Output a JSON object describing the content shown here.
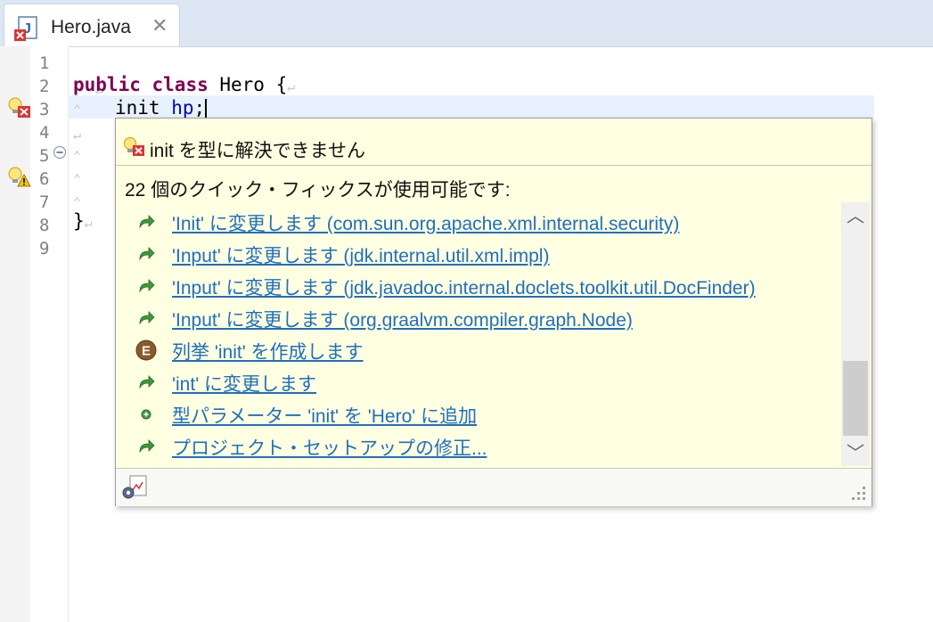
{
  "tab": {
    "title": "Hero.java",
    "close_glyph": "✕",
    "icon": "java-file-error-icon"
  },
  "editor": {
    "line_numbers": [
      "1",
      "2",
      "3",
      "4",
      "5",
      "6",
      "7",
      "8",
      "9"
    ],
    "lines": {
      "l2_kw1": "public",
      "l2_kw2": "class",
      "l2_rest": " Hero {",
      "l3_type": "init",
      "l3_var": "hp",
      "l3_semi": ";",
      "l8": "}"
    },
    "pilcrow": "↵",
    "tab_mark": "⌃"
  },
  "popup": {
    "title": "init を型に解決できません",
    "subtitle": "22 個のクイック・フィックスが使用可能です:",
    "fixes": [
      {
        "label": "'Init' に変更します (com.sun.org.apache.xml.internal.security)",
        "icon": "change-arrow-icon"
      },
      {
        "label": "'Input' に変更します (jdk.internal.util.xml.impl)",
        "icon": "change-arrow-icon"
      },
      {
        "label": "'Input' に変更します (jdk.javadoc.internal.doclets.toolkit.util.DocFinder)",
        "icon": "change-arrow-icon"
      },
      {
        "label": "'Input' に変更します (org.graalvm.compiler.graph.Node)",
        "icon": "change-arrow-icon"
      },
      {
        "label": "列挙 'init' を作成します",
        "icon": "enum-icon"
      },
      {
        "label": "'int' に変更します",
        "icon": "change-arrow-icon"
      },
      {
        "label": "型パラメーター 'init' を 'Hero' に追加",
        "icon": "add-icon"
      },
      {
        "label": "プロジェクト・セットアップの修正...",
        "icon": "change-arrow-icon"
      }
    ],
    "scroll": {
      "up": "︿",
      "down": "﹀"
    }
  },
  "colors": {
    "popup_bg": "#ffffe1",
    "link": "#1f6fbe",
    "keyword": "#7f0055",
    "field": "#0000c0",
    "current_line": "#e8f2fe"
  }
}
